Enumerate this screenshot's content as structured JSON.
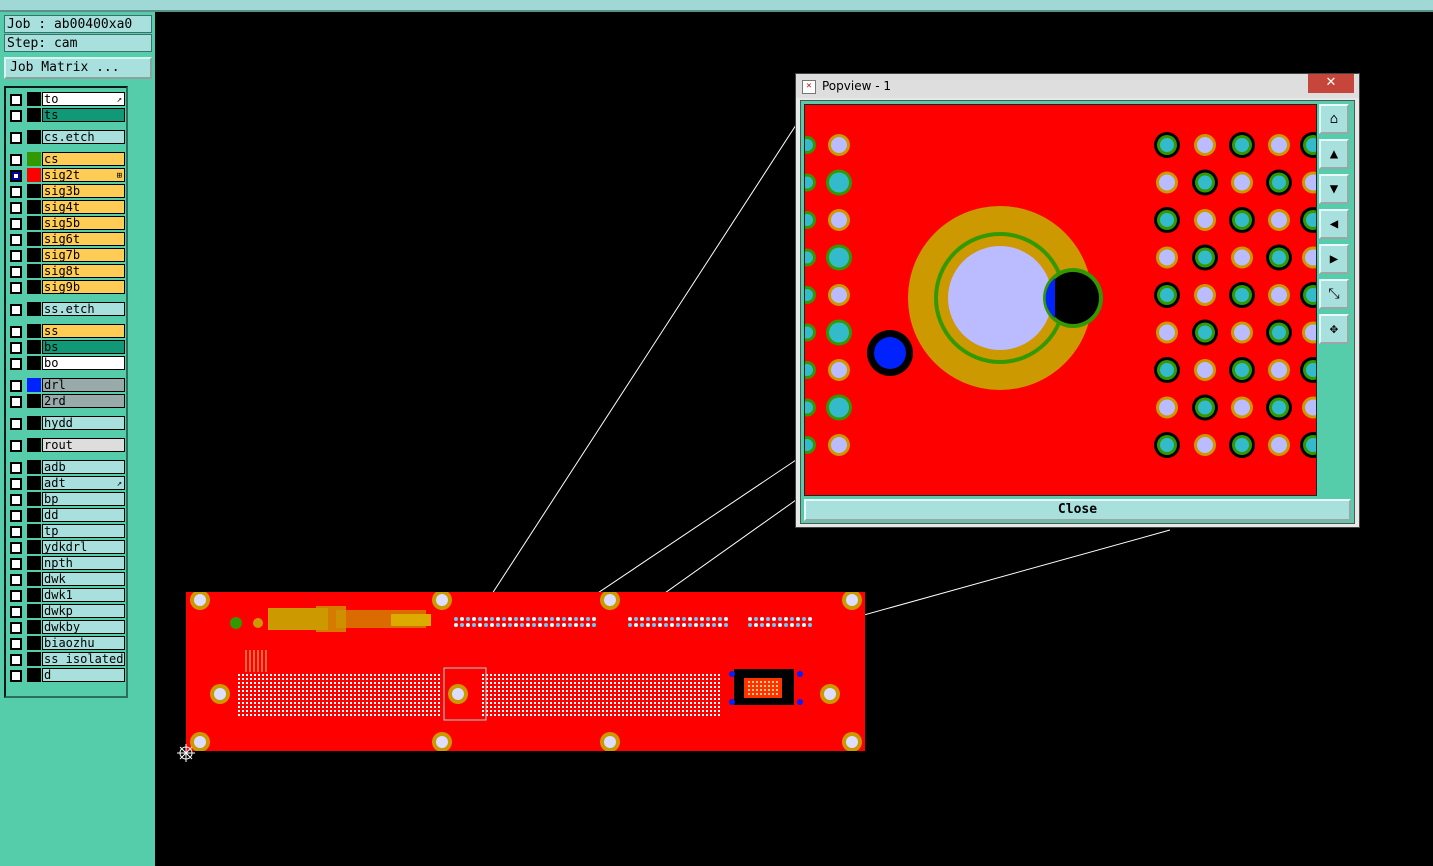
{
  "job": {
    "job_line": "Job : ab00400xa0",
    "step_line": "Step: cam",
    "matrix_button": "Job Matrix ..."
  },
  "layers": [
    {
      "name": "to",
      "color": "#ffffff",
      "mark": "↗",
      "gap_before": false
    },
    {
      "name": "ts",
      "color": "#119977",
      "mark": "",
      "gap_before": false
    },
    {
      "name": "cs.etch",
      "color": "#a8e0dd",
      "mark": "",
      "gap_before": true
    },
    {
      "name": "cs",
      "color": "#ffcc55",
      "mark": "",
      "gap_before": true,
      "swatch": "#339900"
    },
    {
      "name": "sig2t",
      "color": "#ffcc55",
      "mark": "⊞",
      "gap_before": false,
      "swatch": "#ff0000",
      "checked": true
    },
    {
      "name": "sig3b",
      "color": "#ffcc55",
      "mark": "",
      "gap_before": false
    },
    {
      "name": "sig4t",
      "color": "#ffcc55",
      "mark": "",
      "gap_before": false
    },
    {
      "name": "sig5b",
      "color": "#ffcc55",
      "mark": "",
      "gap_before": false
    },
    {
      "name": "sig6t",
      "color": "#ffcc55",
      "mark": "",
      "gap_before": false
    },
    {
      "name": "sig7b",
      "color": "#ffcc55",
      "mark": "",
      "gap_before": false
    },
    {
      "name": "sig8t",
      "color": "#ffcc55",
      "mark": "",
      "gap_before": false
    },
    {
      "name": "sig9b",
      "color": "#ffcc55",
      "mark": "",
      "gap_before": false
    },
    {
      "name": "ss.etch",
      "color": "#a8e0dd",
      "mark": "",
      "gap_before": true
    },
    {
      "name": "ss",
      "color": "#ffcc55",
      "mark": "",
      "gap_before": true
    },
    {
      "name": "bs",
      "color": "#119977",
      "mark": "",
      "gap_before": false
    },
    {
      "name": "bo",
      "color": "#ffffff",
      "mark": "",
      "gap_before": false
    },
    {
      "name": "drl",
      "color": "#99aaaa",
      "mark": "",
      "gap_before": true,
      "swatch": "#0022ff"
    },
    {
      "name": "2rd",
      "color": "#99aaaa",
      "mark": "",
      "gap_before": false
    },
    {
      "name": "hydd",
      "color": "#a8e0dd",
      "mark": "",
      "gap_before": true
    },
    {
      "name": "rout",
      "color": "#dddddd",
      "mark": "",
      "gap_before": true
    },
    {
      "name": "adb",
      "color": "#a8e0dd",
      "mark": "",
      "gap_before": true
    },
    {
      "name": "adt",
      "color": "#a8e0dd",
      "mark": "↗",
      "gap_before": false
    },
    {
      "name": "bp",
      "color": "#a8e0dd",
      "mark": "",
      "gap_before": false
    },
    {
      "name": "dd",
      "color": "#a8e0dd",
      "mark": "",
      "gap_before": false
    },
    {
      "name": "tp",
      "color": "#a8e0dd",
      "mark": "",
      "gap_before": false
    },
    {
      "name": "ydkdrl",
      "color": "#a8e0dd",
      "mark": "",
      "gap_before": false
    },
    {
      "name": "npth",
      "color": "#a8e0dd",
      "mark": "",
      "gap_before": false
    },
    {
      "name": "dwk",
      "color": "#a8e0dd",
      "mark": "",
      "gap_before": false
    },
    {
      "name": "dwk1",
      "color": "#a8e0dd",
      "mark": "",
      "gap_before": false
    },
    {
      "name": "dwkp",
      "color": "#a8e0dd",
      "mark": "",
      "gap_before": false
    },
    {
      "name": "dwkby",
      "color": "#a8e0dd",
      "mark": "",
      "gap_before": false
    },
    {
      "name": "biaozhu",
      "color": "#a8e0dd",
      "mark": "",
      "gap_before": false
    },
    {
      "name": "ss_isolated",
      "color": "#a8e0dd",
      "mark": "",
      "gap_before": false
    },
    {
      "name": "d",
      "color": "#a8e0dd",
      "mark": "",
      "gap_before": false
    }
  ],
  "popview": {
    "title": "Popview - 1",
    "close_x": "✕",
    "close_button": "Close",
    "tools": [
      "zoom-home-icon",
      "move-up-icon",
      "move-down-icon",
      "move-left-icon",
      "move-right-icon",
      "zoom-out-icon",
      "zoom-in-icon"
    ]
  },
  "colors": {
    "board": "#ff0000",
    "copper": "#cc9900",
    "drill": "#0022ff",
    "panel": "#55ccaa",
    "button": "#a8e0dd"
  }
}
